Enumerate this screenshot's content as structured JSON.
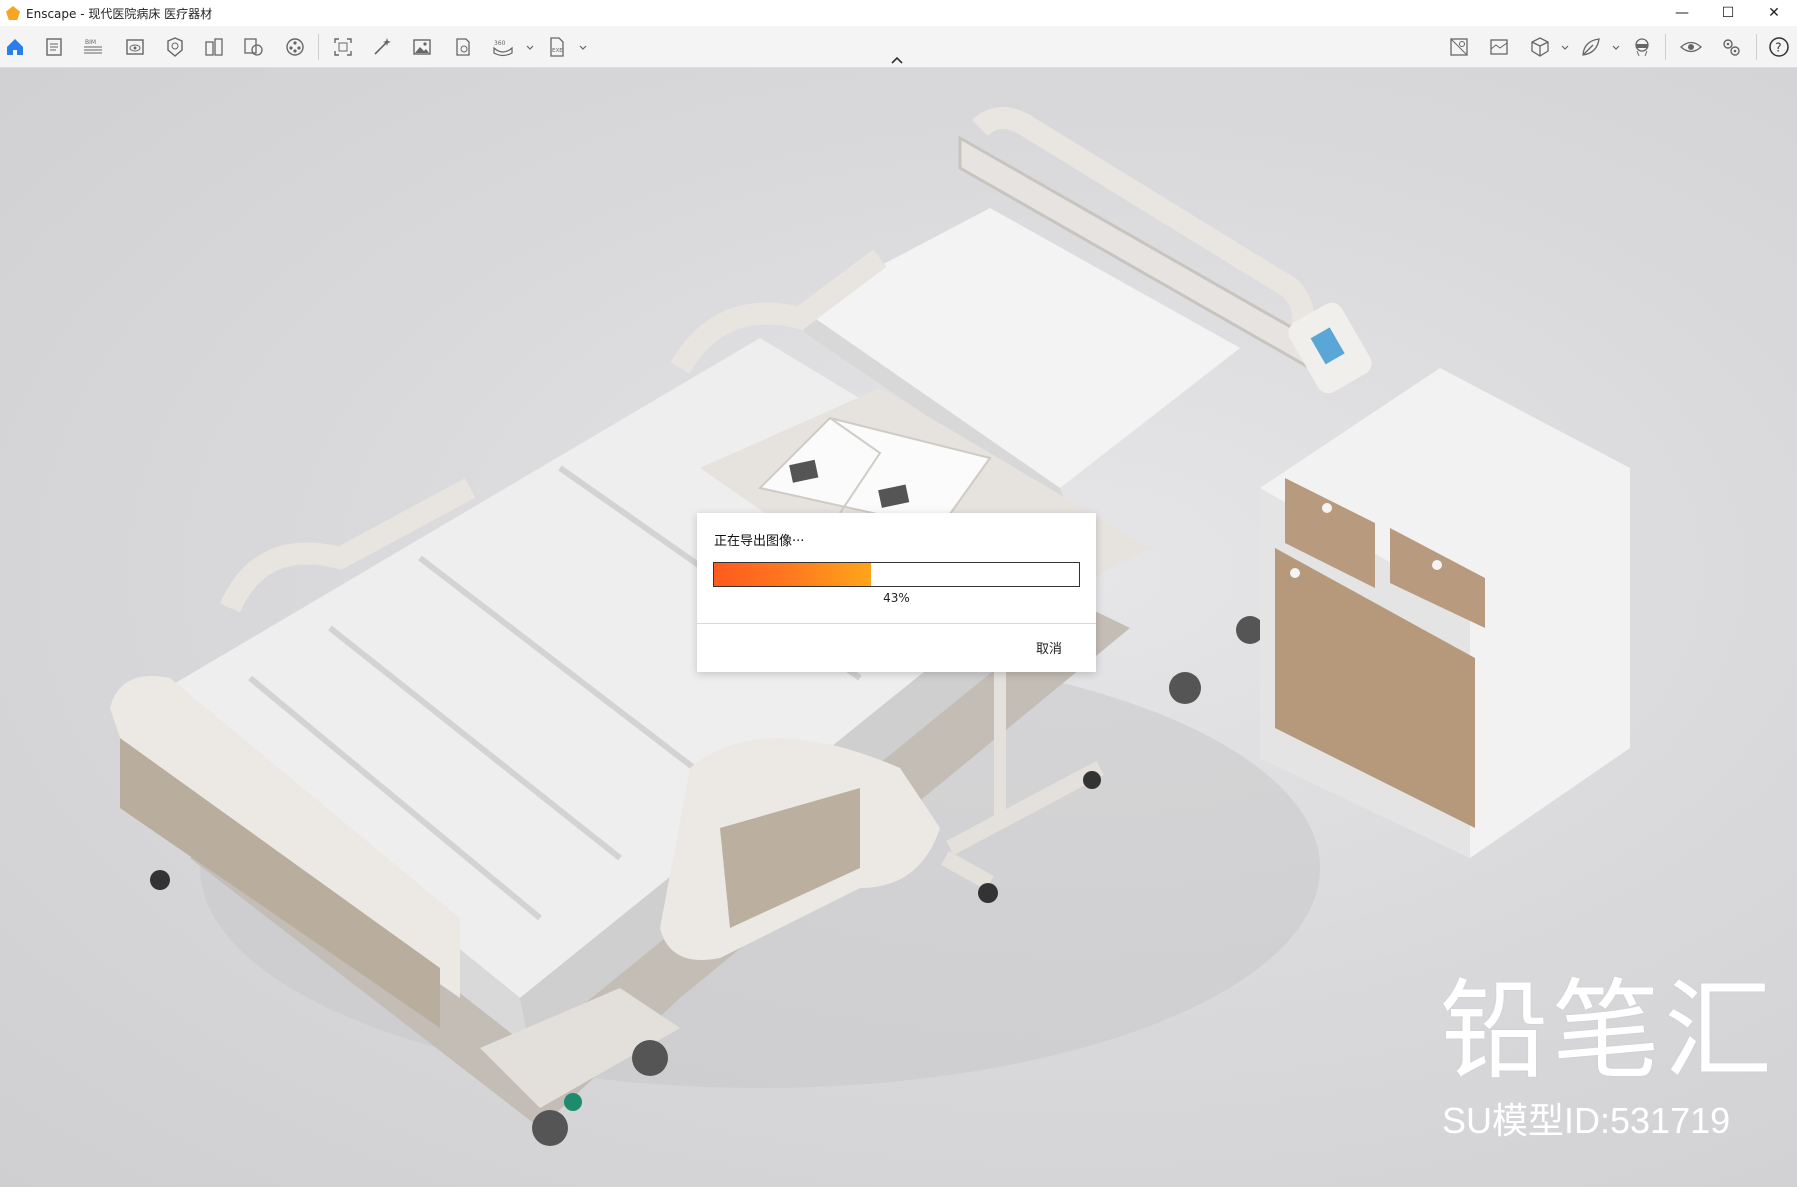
{
  "window": {
    "title": "Enscape - 现代医院病床 医疗器材",
    "minimize_glyph": "—",
    "maximize_glyph": "☐",
    "close_glyph": "✕"
  },
  "toolbar": {
    "left_icons": [
      "home-icon",
      "document-icon",
      "bim-icon",
      "view-icon",
      "asset-library-icon",
      "building-icon",
      "material-icon",
      "video-icon",
      "screenshot-icon",
      "magic-wand-icon",
      "image-icon",
      "batch-render-icon",
      "panorama-360-icon",
      "exe-export-icon"
    ],
    "bim_label": "BIM",
    "label_360": "360",
    "exe_label": "EXE",
    "right_icons": [
      "atmosphere-icon",
      "sky-icon",
      "box-icon",
      "vr-headset-icon",
      "eye-icon",
      "settings-icon",
      "help-icon"
    ],
    "help_glyph": "?",
    "accent_color": "#2b7de9"
  },
  "dialog": {
    "title": "正在导出图像···",
    "progress_percent": 43,
    "progress_label": "43%",
    "cancel_label": "取消"
  },
  "watermark": {
    "brand": "铅笔汇",
    "model_id": "SU模型ID:531719"
  }
}
